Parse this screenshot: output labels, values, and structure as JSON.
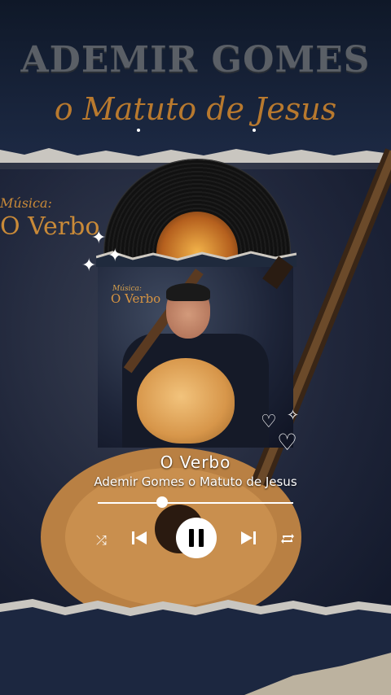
{
  "poster": {
    "artist_heading": "ADEMIR GOMES",
    "artist_subheading": "o Matuto de Jesus",
    "background_label_small": "Música:",
    "background_label_big": "O Verbo"
  },
  "cover": {
    "label_small": "Música:",
    "label_big": "O Verbo"
  },
  "player": {
    "song_title": "O Verbo",
    "artist_name": "Ademir Gomes o Matuto de Jesus",
    "progress": 0.33
  },
  "icons": {
    "shuffle": "shuffle-icon",
    "previous": "skip-previous-icon",
    "play_pause": "pause-icon",
    "next": "skip-next-icon",
    "repeat": "repeat-icon"
  },
  "colors": {
    "accent_gold": "#c98a38",
    "text_white": "#ffffff",
    "heading_gray": "#5a5f66"
  }
}
